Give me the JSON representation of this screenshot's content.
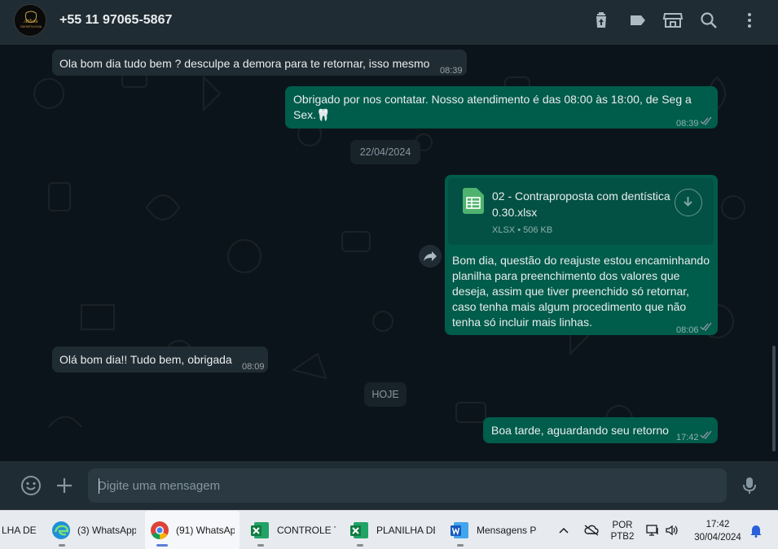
{
  "header": {
    "contact_name": "+55 11 97065-5867",
    "avatar_text": "Athos Odontologia",
    "icons": [
      "delete-icon",
      "label-icon",
      "store-icon",
      "search-icon",
      "menu-icon"
    ]
  },
  "messages": [
    {
      "direction": "in",
      "text": "Ola bom dia tudo bem ? desculpe a demora para te retornar, isso mesmo",
      "time": "08:39"
    },
    {
      "direction": "out",
      "text": "Obrigado por nos contatar. Nosso atendimento é das 08:00 às 18:00, de Seg a Sex.🦷",
      "time": "08:39",
      "status": "read"
    },
    {
      "type": "date",
      "text": "22/04/2024"
    },
    {
      "direction": "out",
      "file": {
        "name": "02 - Contraproposta com dentística 0.30.xlsx",
        "type": "XLSX",
        "size": "506 KB"
      },
      "text": "Bom dia, questão do reajuste estou encaminhando planilha para preenchimento dos valores que deseja, assim que tiver preenchido só retornar, caso tenha mais algum procedimento que não tenha só incluir mais linhas.",
      "time": "08:06",
      "status": "read"
    },
    {
      "direction": "in",
      "text": "Olá bom dia!! Tudo bem, obrigada",
      "time": "08:09"
    },
    {
      "type": "date",
      "text": "HOJE"
    },
    {
      "direction": "out",
      "text": "Boa tarde, aguardando seu retorno",
      "time": "17:42",
      "status": "read"
    }
  ],
  "composer": {
    "placeholder": "Digite uma mensagem",
    "value": ""
  },
  "taskbar": {
    "items": [
      {
        "label": "LHA DE",
        "icon": "excel-icon"
      },
      {
        "label": "(3) WhatsApp",
        "icon": "edge-icon"
      },
      {
        "label": "(91) WhatsAp",
        "icon": "chrome-icon",
        "active": true
      },
      {
        "label": "CONTROLE T",
        "icon": "excel-icon"
      },
      {
        "label": "PLANILHA DE",
        "icon": "excel-icon"
      },
      {
        "label": "Mensagens P",
        "icon": "word-icon"
      }
    ],
    "language": "POR",
    "keyboard": "PTB2",
    "time": "17:42",
    "date": "30/04/2024"
  },
  "colors": {
    "header_bg": "#202c33",
    "chat_bg": "#0b141a",
    "incoming_bubble": "#202c33",
    "outgoing_bubble": "#005c4b",
    "read_ticks": "#8696a0",
    "taskbar_bg": "#e7eaef"
  }
}
